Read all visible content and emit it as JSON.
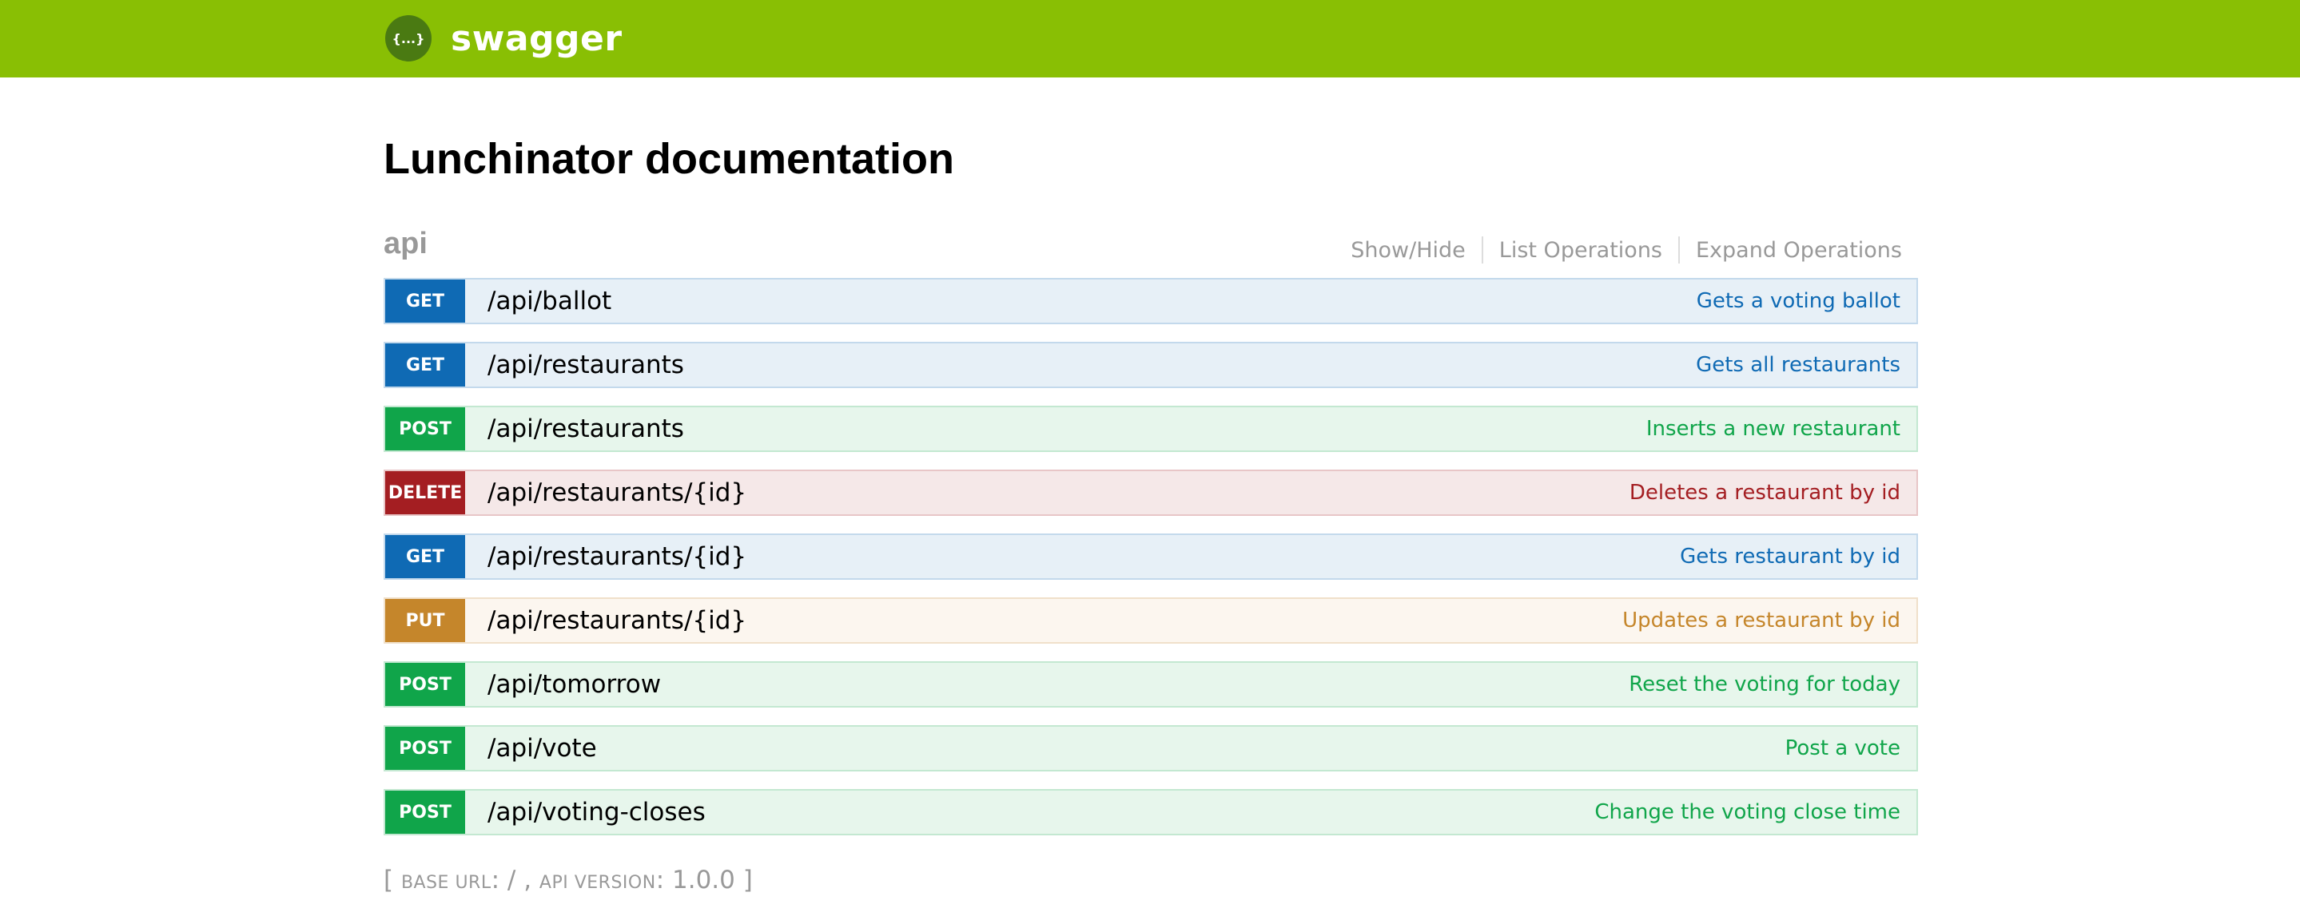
{
  "header": {
    "brand": "swagger",
    "logo_glyph": "{...}"
  },
  "page_title": "Lunchinator documentation",
  "resource": {
    "name": "api",
    "actions": [
      "Show/Hide",
      "List Operations",
      "Expand Operations"
    ]
  },
  "operations": [
    {
      "method": "GET",
      "path": "/api/ballot",
      "summary": "Gets a voting ballot"
    },
    {
      "method": "GET",
      "path": "/api/restaurants",
      "summary": "Gets all restaurants"
    },
    {
      "method": "POST",
      "path": "/api/restaurants",
      "summary": "Inserts a new restaurant"
    },
    {
      "method": "DELETE",
      "path": "/api/restaurants/{id}",
      "summary": "Deletes a restaurant by id"
    },
    {
      "method": "GET",
      "path": "/api/restaurants/{id}",
      "summary": "Gets restaurant by id"
    },
    {
      "method": "PUT",
      "path": "/api/restaurants/{id}",
      "summary": "Updates a restaurant by id"
    },
    {
      "method": "POST",
      "path": "/api/tomorrow",
      "summary": "Reset the voting for today"
    },
    {
      "method": "POST",
      "path": "/api/vote",
      "summary": "Post a vote"
    },
    {
      "method": "POST",
      "path": "/api/voting-closes",
      "summary": "Change the voting close time"
    }
  ],
  "footer": {
    "open": "[ ",
    "base_url_label": "base url",
    "base_url_value": ": / , ",
    "api_version_label": "api version",
    "api_version_value": ": 1.0.0 ]"
  },
  "colors": {
    "header_bg": "#89bf04",
    "get": "#0f6ab4",
    "post": "#10a54a",
    "delete": "#a41e22",
    "put": "#c5862b"
  }
}
